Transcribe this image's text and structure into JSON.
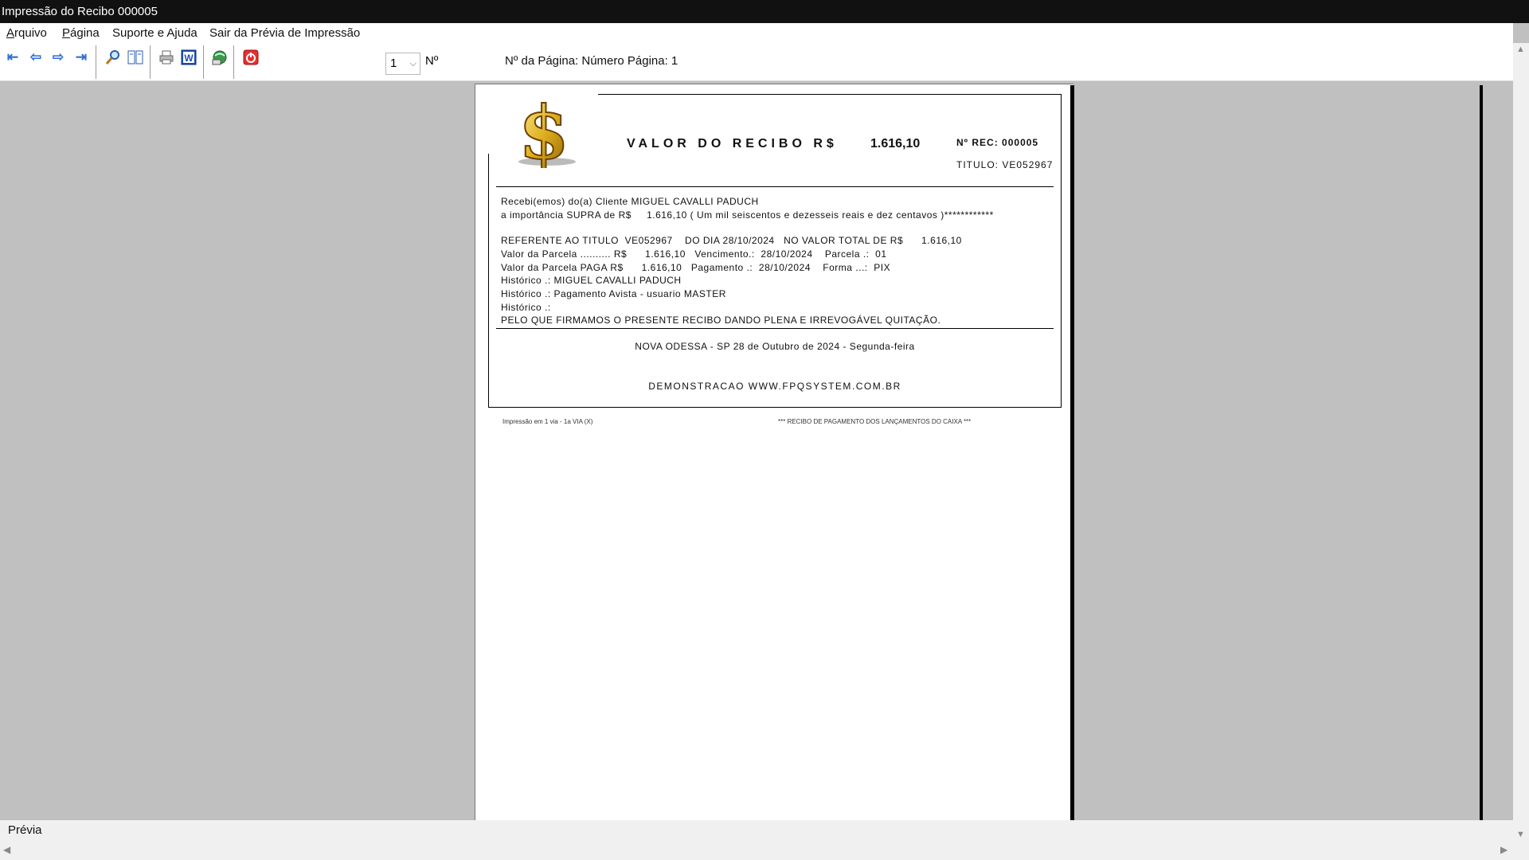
{
  "window": {
    "title": "Impressão do Recibo 000005"
  },
  "menu": {
    "items": [
      "Arquivo",
      "Página",
      "Suporte e Ajuda",
      "Sair da Prévia de Impressão"
    ]
  },
  "toolbar": {
    "icons": [
      "first-page-icon",
      "prev-page-icon",
      "next-page-icon",
      "last-page-icon",
      "zoom-icon",
      "two-pages-icon",
      "printer-icon",
      "word-icon",
      "export-icon",
      "exit-icon"
    ],
    "page_select_value": "1",
    "no_label": "Nº",
    "page_info": "Nº da Página: Número Página: 1"
  },
  "receipt": {
    "heading": "VALOR DO RECIBO R$",
    "heading_value": "1.616,10",
    "rec_number": "Nº REC: 000005",
    "titulo": "TITULO: VE052967",
    "lines": [
      "Recebi(emos) do(a) Cliente MIGUEL CAVALLI PADUCH",
      "a importância SUPRA de R$     1.616,10 ( Um mil seiscentos e dezesseis reais e dez centavos )************",
      "REFERENTE AO TITULO  VE052967    DO DIA 28/10/2024   NO VALOR TOTAL DE R$      1.616,10",
      "Valor da Parcela .......... R$      1.616,10   Vencimento.:  28/10/2024    Parcela .:  01",
      "Valor da Parcela PAGA R$      1.616,10   Pagamento .:  28/10/2024    Forma ...:  PIX",
      "Histórico .: MIGUEL CAVALLI PADUCH",
      "Histórico .: Pagamento Avista - usuario MASTER",
      "Histórico .:",
      "PELO QUE FIRMAMOS O PRESENTE RECIBO DANDO PLENA E IRREVOGÁVEL QUITAÇÃO."
    ],
    "place_date": "NOVA ODESSA - SP 28 de Outubro de 2024 - Segunda-feira",
    "demo": "DEMONSTRACAO WWW.FPQSYSTEM.COM.BR",
    "footer_left": "Impressão em 1 via  -  1a VIA (X)",
    "footer_right": "*** RECIBO DE PAGAMENTO DOS LANÇAMENTOS DO CAIXA ***"
  },
  "status": {
    "text": "Prévia"
  }
}
